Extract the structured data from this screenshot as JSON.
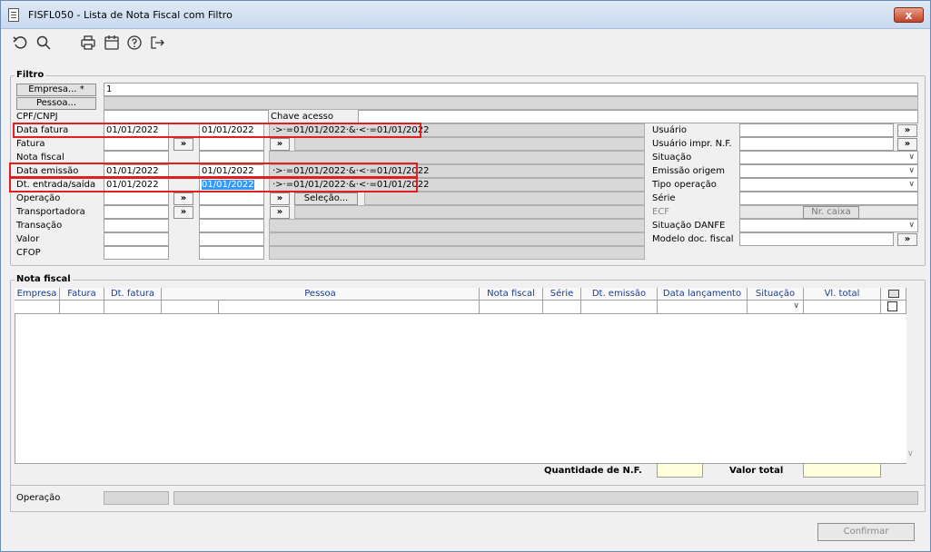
{
  "window": {
    "title": "FISFL050 - Lista de Nota Fiscal com Filtro",
    "close_label": "x"
  },
  "toolbar": {
    "icons": [
      "undo-icon",
      "search-icon",
      "print-icon",
      "calendar-icon",
      "help-icon",
      "exit-icon"
    ]
  },
  "filtro": {
    "group_label": "Filtro",
    "empresa_button": "Empresa... *",
    "empresa_value": "1",
    "pessoa_button": "Pessoa...",
    "cpf_label": "CPF/CNPJ",
    "chave_acesso_label": "Chave acesso",
    "data_fatura_label": "Data fatura",
    "data_fatura_from": "01/01/2022",
    "data_fatura_to": "01/01/2022",
    "data_fatura_expr": "·>·=01/01/2022·&·<·=01/01/2022",
    "fatura_label": "Fatura",
    "nota_fiscal_label": "Nota fiscal",
    "data_emissao_label": "Data emissão",
    "data_emissao_from": "01/01/2022",
    "data_emissao_to": "01/01/2022",
    "data_emissao_expr": "·>·=01/01/2022·&·<·=01/01/2022",
    "dt_entrada_label": "Dt. entrada/saída",
    "dt_entrada_from": "01/01/2022",
    "dt_entrada_to": "01/01/2022",
    "dt_entrada_expr": "·>·=01/01/2022·&·<·=01/01/2022",
    "operacao_label": "Operação",
    "selecao_button": "Seleção...",
    "transportadora_label": "Transportadora",
    "transacao_label": "Transação",
    "valor_label": "Valor",
    "cfop_label": "CFOP",
    "arrow_label": "»",
    "usuario_label": "Usuário",
    "usuario_impr_label": "Usuário impr. N.F.",
    "situacao_label": "Situação",
    "emissao_origem_label": "Emissão origem",
    "tipo_operacao_label": "Tipo operação",
    "serie_label": "Série",
    "ecf_label": "ECF",
    "nr_caixa_button": "Nr. caixa",
    "situacao_danfe_label": "Situação DANFE",
    "modelo_doc_label": "Modelo doc. fiscal"
  },
  "nota_fiscal": {
    "group_label": "Nota fiscal",
    "columns": [
      "Empresa",
      "Fatura",
      "Dt. fatura",
      "Pessoa",
      "Nota fiscal",
      "Série",
      "Dt. emissão",
      "Data lançamento",
      "Situação",
      "Vl. total"
    ],
    "quantidade_label": "Quantidade de N.F.",
    "valor_total_label": "Valor total"
  },
  "footer": {
    "operacao_label": "Operação",
    "confirmar_button": "Confirmar"
  }
}
